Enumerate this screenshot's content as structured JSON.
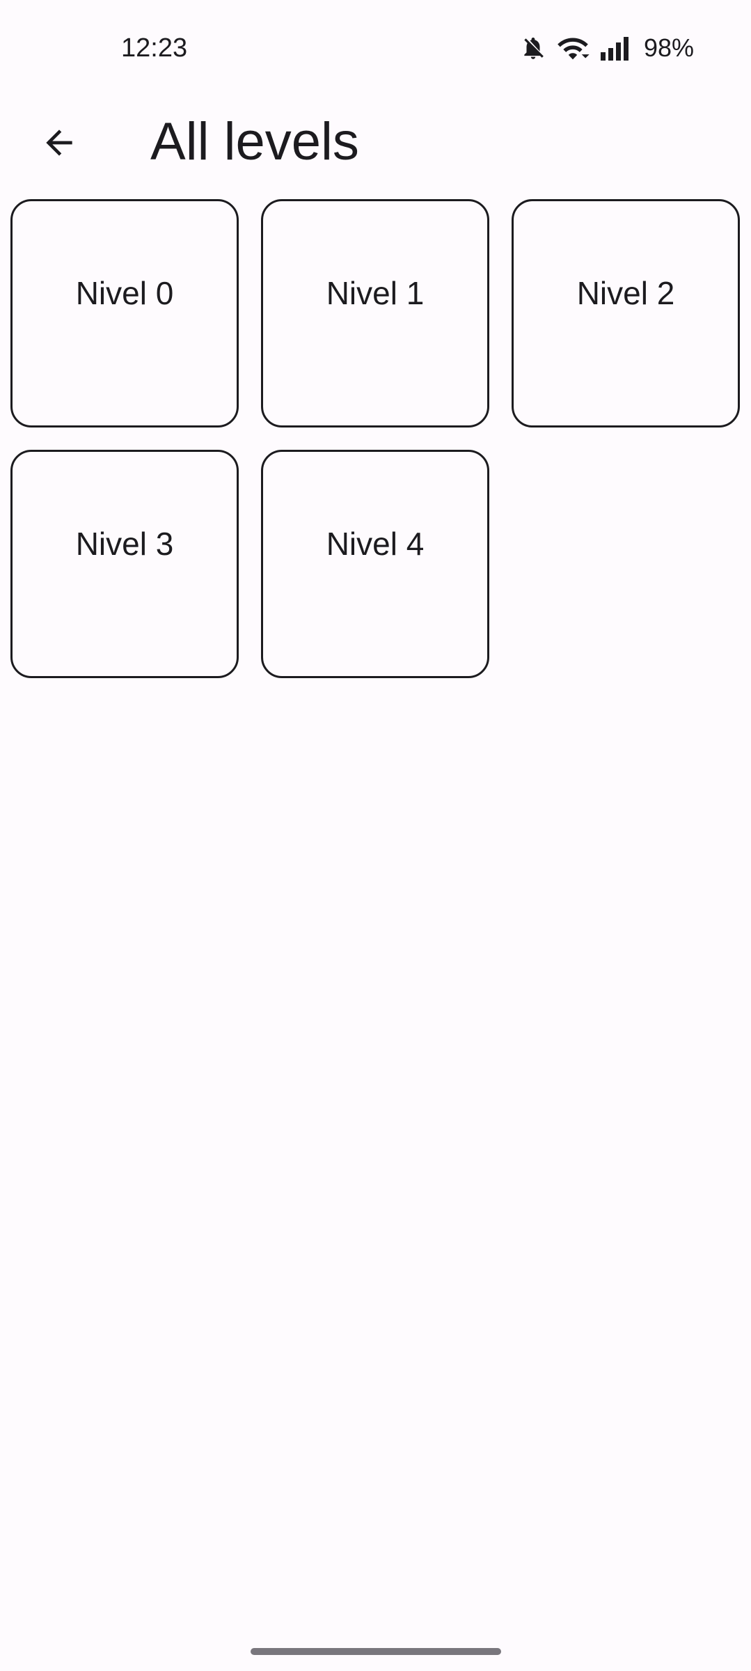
{
  "status_bar": {
    "time": "12:23",
    "battery": "98%",
    "icons": [
      "bell-off-icon",
      "wifi-icon",
      "signal-icon"
    ]
  },
  "app_bar": {
    "back_icon": "arrow-left-icon",
    "title": "All levels"
  },
  "levels": [
    {
      "label": "Nivel 0"
    },
    {
      "label": "Nivel 1"
    },
    {
      "label": "Nivel 2"
    },
    {
      "label": "Nivel 3"
    },
    {
      "label": "Nivel 4"
    }
  ],
  "colors": {
    "background": "#fefbfe",
    "text": "#1c1b1f",
    "card_border": "#1c1b1f",
    "home_indicator": "#79767d"
  }
}
